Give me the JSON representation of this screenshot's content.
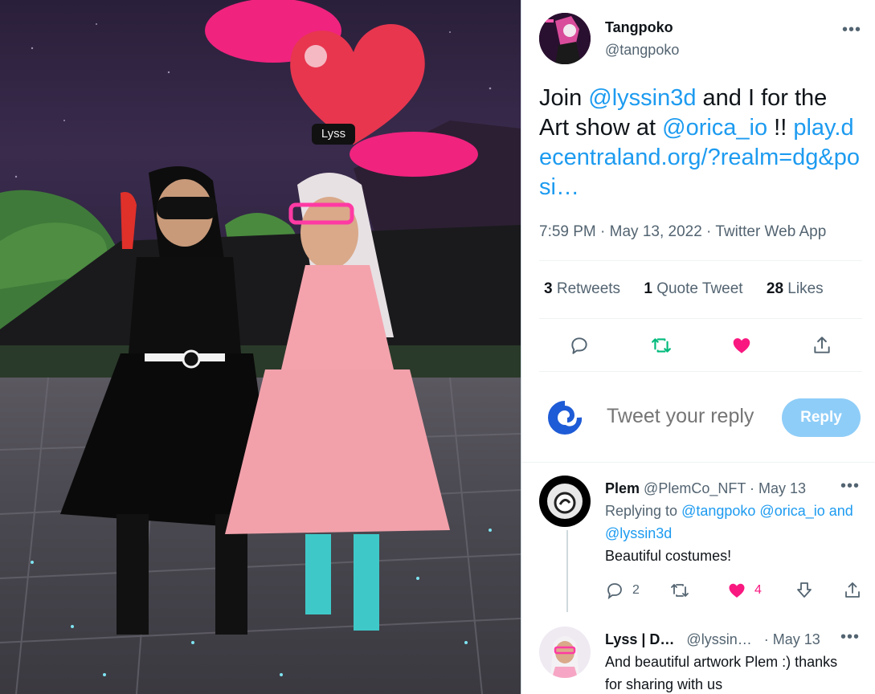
{
  "media": {
    "name_tag": "Lyss"
  },
  "tweet": {
    "display_name": "Tangpoko",
    "handle": "@tangpoko",
    "text_1": "Join ",
    "mention_1": "@lyssin3d",
    "text_2": " and I for the Art show at ",
    "mention_2": "@orica_io",
    "text_3": " !! ",
    "link": "play.decentraland.org/?realm=dg&posi…",
    "timestamp": "7:59 PM · May 13, 2022 · Twitter Web App",
    "stats": {
      "retweets_count": "3",
      "retweets_label": "Retweets",
      "quotes_count": "1",
      "quotes_label": "Quote Tweet",
      "likes_count": "28",
      "likes_label": "Likes"
    }
  },
  "reply_box": {
    "placeholder": "Tweet your reply",
    "button_label": "Reply"
  },
  "replies": [
    {
      "display_name": "Plem",
      "handle": "@PlemCo_NFT",
      "date": "· May 13",
      "replying_to_label": "Replying to ",
      "replying_to_1": "@tangpoko",
      "replying_to_2": "@orica_io",
      "replying_to_and": "and",
      "replying_to_3": "@lyssin3d",
      "text": "Beautiful costumes!",
      "reply_count": "2",
      "like_count": "4"
    },
    {
      "display_name": "Lyss | D…",
      "handle": "@lyssin…",
      "date": "· May 13",
      "text": "And beautiful artwork Plem :) thanks for sharing with us"
    }
  ],
  "colors": {
    "accent": "#1d9bf0",
    "retweet_green": "#00ba7c",
    "like_pink": "#f91880",
    "reply_button_disabled": "#8ecdf8"
  }
}
